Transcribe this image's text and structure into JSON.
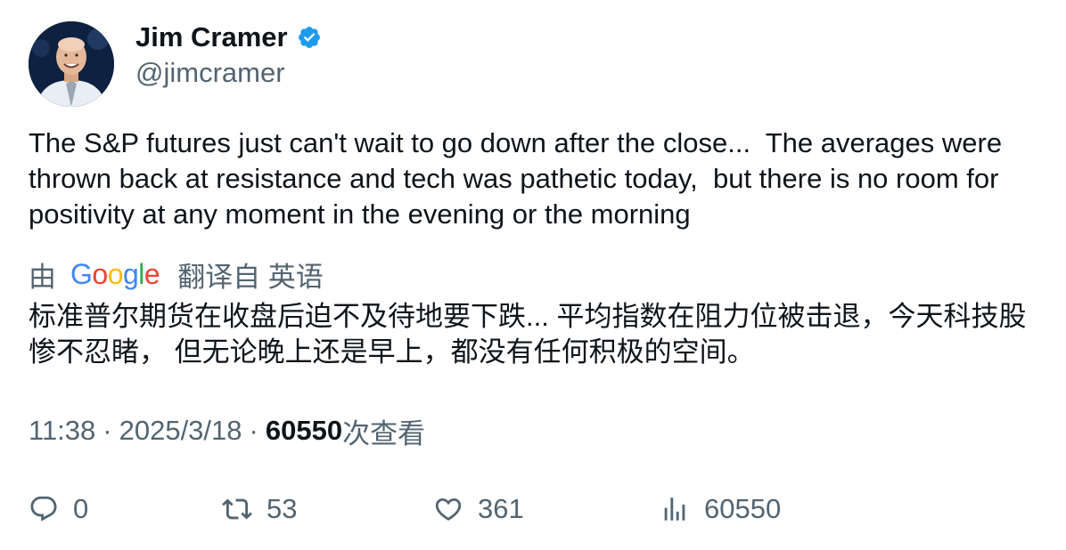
{
  "author": {
    "display_name": "Jim Cramer",
    "handle": "@jimcramer",
    "verified": true,
    "verified_color": "#1d9bf0"
  },
  "tweet": {
    "text": "The S&P futures just can't wait to go down after the close...  The averages were thrown back at resistance and tech was pathetic today,  but there is no room for positivity at any moment in the evening or the morning"
  },
  "translation": {
    "by_label": "由",
    "provider": "Google",
    "label": "翻译自 英语",
    "text": "标准普尔期货在收盘后迫不及待地要下跌... 平均指数在阻力位被击退，今天科技股惨不忍睹， 但无论晚上还是早上，都没有任何积极的空间。"
  },
  "meta": {
    "time": "11:38",
    "separator": "·",
    "date": "2025/3/18",
    "views_count": "60550",
    "views_label": "次查看"
  },
  "actions": {
    "reply": {
      "icon": "reply-icon",
      "count": "0"
    },
    "retweet": {
      "icon": "retweet-icon",
      "count": "53"
    },
    "like": {
      "icon": "heart-icon",
      "count": "361"
    },
    "views": {
      "icon": "analytics-icon",
      "count": "60550"
    }
  },
  "colors": {
    "text_primary": "#0f1419",
    "text_secondary": "#536471",
    "google_blue": "#4285f4",
    "google_red": "#ea4335",
    "google_yellow": "#fbbc05",
    "google_green": "#34a853"
  }
}
